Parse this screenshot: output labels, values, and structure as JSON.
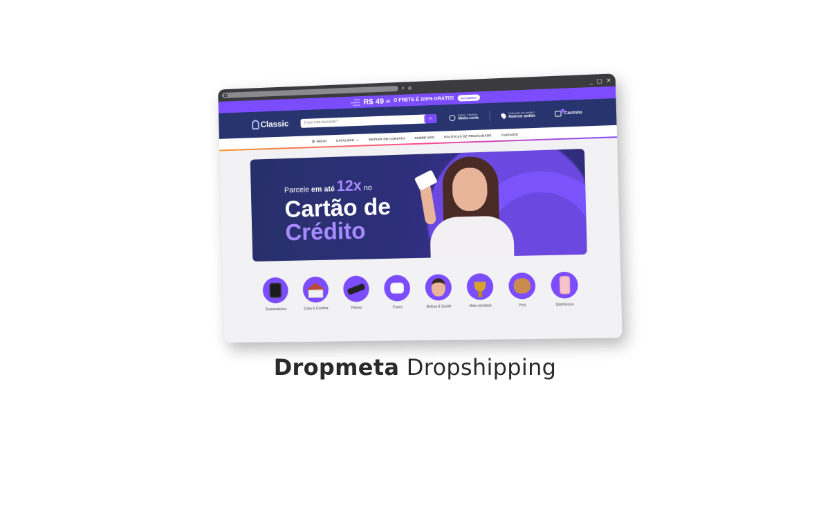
{
  "browser": {
    "window_controls": [
      "_",
      "□",
      "✕"
    ],
    "chrome_icons": [
      "search-icon",
      "home-icon"
    ]
  },
  "promo": {
    "prefix": "Para pedidos acima",
    "price": "R$ 49",
    "cents": ",90",
    "frete": "O FRETE É 100% GRÁTIS!",
    "cta": "EU QUERO!"
  },
  "header": {
    "logo": "Classic",
    "search_placeholder": "O que está buscando?",
    "account_line1": "Entrar | Cadastrar",
    "account_line2": "Minha conta",
    "track_line1": "Onde está meu pedido?",
    "track_line2": "Rastrear pedido",
    "cart_label": "Carrinho",
    "cart_count": "0"
  },
  "nav": {
    "items": [
      "INÍCIO",
      "CATÁLOGO",
      "ENTRAR EM CONTATO",
      "SOBRE NÓS",
      "POLÍTICAS DE PRIVACIDADE",
      "CUIDADO!"
    ]
  },
  "banner": {
    "l1_a": "Parcele",
    "l1_b": "em até",
    "l1_big": "12x",
    "l1_c": "no",
    "l2": "Cartão de",
    "l3": "Crédito",
    "colors": {
      "bg": "#28306a",
      "accent": "#7c4dff",
      "light_accent": "#a98bff"
    }
  },
  "categories": [
    {
      "label": "Smartwatches",
      "icon": "watch-icon"
    },
    {
      "label": "Casa & Cozinha",
      "icon": "house-icon"
    },
    {
      "label": "Fitness",
      "icon": "dumbbell-icon"
    },
    {
      "label": "Fones",
      "icon": "earbuds-icon"
    },
    {
      "label": "Beleza & Saúde",
      "icon": "beauty-icon"
    },
    {
      "label": "Mais vendidos",
      "icon": "trophy-icon"
    },
    {
      "label": "Pets",
      "icon": "pets-icon"
    },
    {
      "label": "Eletrônicos",
      "icon": "phone-icon"
    }
  ],
  "caption": {
    "bold": "Dropmeta",
    "light": "Dropshipping"
  }
}
